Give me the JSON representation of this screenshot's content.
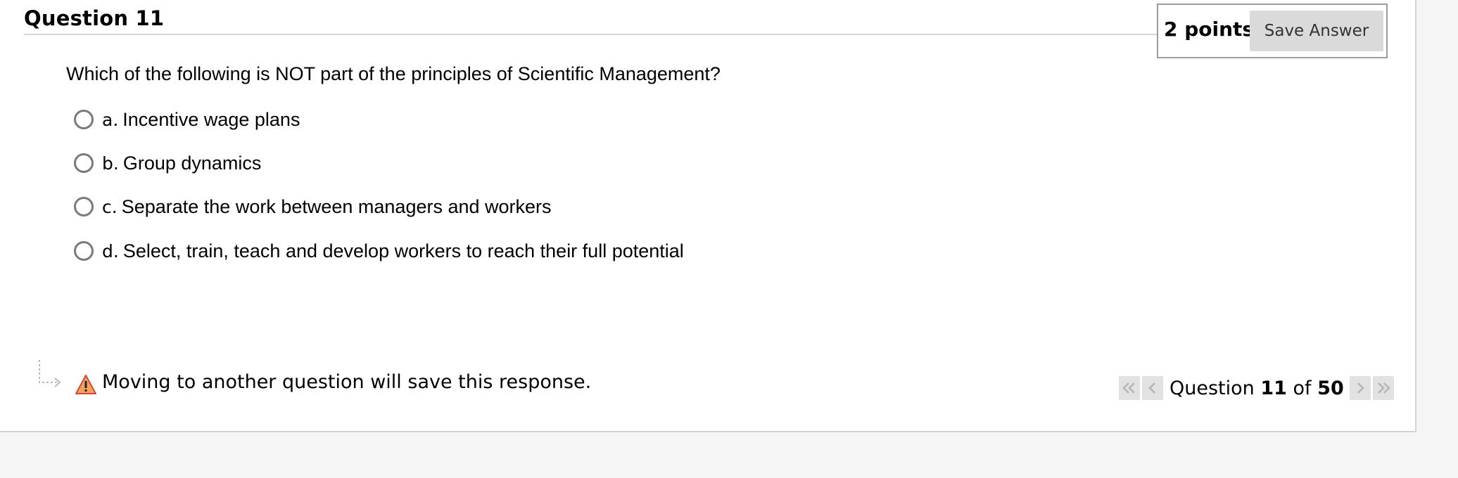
{
  "question": {
    "title": "Question 11",
    "points": "2 points",
    "save_label": "Save Answer",
    "prompt": "Which of the following is NOT part of the principles of Scientific Management?",
    "options": [
      {
        "letter": "a.",
        "text": "Incentive wage plans"
      },
      {
        "letter": "b.",
        "text": "Group dynamics"
      },
      {
        "letter": "c.",
        "text": "Separate the work between managers and workers"
      },
      {
        "letter": "d.",
        "text": "Select, train, teach and develop workers to reach their full potential"
      }
    ]
  },
  "footer": {
    "warning": "Moving to another question will save this response."
  },
  "nav": {
    "prefix": "Question",
    "current": "11",
    "of": "of",
    "total": "50"
  }
}
